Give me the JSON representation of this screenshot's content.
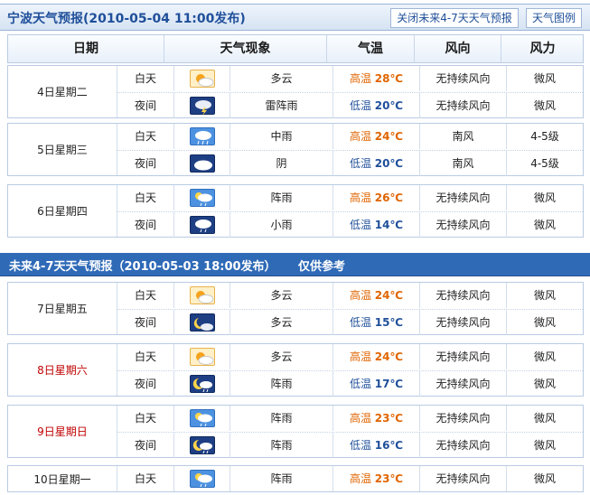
{
  "header": {
    "title": "宁波天气预报(2010-05-04 11:00发布)",
    "close_btn": "关闭未来4-7天天气预报",
    "legend_btn": "天气图例"
  },
  "columns": [
    "日期",
    "天气现象",
    "气温",
    "风向",
    "风力"
  ],
  "section2": {
    "title": "未来4-7天天气预报（2010-05-03 18:00发布）",
    "note": "仅供参考"
  },
  "temp_labels": {
    "high": "高温",
    "low": "低温"
  },
  "days": [
    {
      "date": "4日星期二",
      "weekend": false,
      "rows": [
        {
          "period": "白天",
          "icon": "partly-cloudy-day-icon",
          "phen": "多云",
          "temp_type": "high",
          "temp": "28℃",
          "wind_dir": "无持续风向",
          "wind_force": "微风"
        },
        {
          "period": "夜间",
          "icon": "thunderstorm-night-icon",
          "phen": "雷阵雨",
          "temp_type": "low",
          "temp": "20℃",
          "wind_dir": "无持续风向",
          "wind_force": "微风"
        }
      ]
    },
    {
      "date": "5日星期三",
      "weekend": false,
      "rows": [
        {
          "period": "白天",
          "icon": "moderate-rain-day-icon",
          "phen": "中雨",
          "temp_type": "high",
          "temp": "24℃",
          "wind_dir": "南风",
          "wind_force": "4-5级"
        },
        {
          "period": "夜间",
          "icon": "overcast-night-icon",
          "phen": "阴",
          "temp_type": "low",
          "temp": "20℃",
          "wind_dir": "南风",
          "wind_force": "4-5级"
        }
      ]
    },
    {
      "date": "6日星期四",
      "weekend": false,
      "rows": [
        {
          "period": "白天",
          "icon": "shower-day-icon",
          "phen": "阵雨",
          "temp_type": "high",
          "temp": "26℃",
          "wind_dir": "无持续风向",
          "wind_force": "微风"
        },
        {
          "period": "夜间",
          "icon": "light-rain-night-icon",
          "phen": "小雨",
          "temp_type": "low",
          "temp": "14℃",
          "wind_dir": "无持续风向",
          "wind_force": "微风"
        }
      ]
    },
    {
      "date": "7日星期五",
      "weekend": false,
      "rows": [
        {
          "period": "白天",
          "icon": "partly-cloudy-day-icon",
          "phen": "多云",
          "temp_type": "high",
          "temp": "24℃",
          "wind_dir": "无持续风向",
          "wind_force": "微风"
        },
        {
          "period": "夜间",
          "icon": "partly-cloudy-night-icon",
          "phen": "多云",
          "temp_type": "low",
          "temp": "15℃",
          "wind_dir": "无持续风向",
          "wind_force": "微风"
        }
      ]
    },
    {
      "date": "8日星期六",
      "weekend": true,
      "rows": [
        {
          "period": "白天",
          "icon": "partly-cloudy-day-icon",
          "phen": "多云",
          "temp_type": "high",
          "temp": "24℃",
          "wind_dir": "无持续风向",
          "wind_force": "微风"
        },
        {
          "period": "夜间",
          "icon": "shower-night-icon",
          "phen": "阵雨",
          "temp_type": "low",
          "temp": "17℃",
          "wind_dir": "无持续风向",
          "wind_force": "微风"
        }
      ]
    },
    {
      "date": "9日星期日",
      "weekend": true,
      "rows": [
        {
          "period": "白天",
          "icon": "shower-day-icon",
          "phen": "阵雨",
          "temp_type": "high",
          "temp": "23℃",
          "wind_dir": "无持续风向",
          "wind_force": "微风"
        },
        {
          "period": "夜间",
          "icon": "shower-night-icon",
          "phen": "阵雨",
          "temp_type": "low",
          "temp": "16℃",
          "wind_dir": "无持续风向",
          "wind_force": "微风"
        }
      ]
    },
    {
      "date": "10日星期一",
      "weekend": false,
      "rows": [
        {
          "period": "白天",
          "icon": "shower-day-icon",
          "phen": "阵雨",
          "temp_type": "high",
          "temp": "23℃",
          "wind_dir": "无持续风向",
          "wind_force": "微风"
        }
      ]
    }
  ],
  "colors": {
    "high": "#e06400",
    "low": "#1f4f9a",
    "weekend": "#c00000",
    "title_bar": "#2f6ab7"
  }
}
